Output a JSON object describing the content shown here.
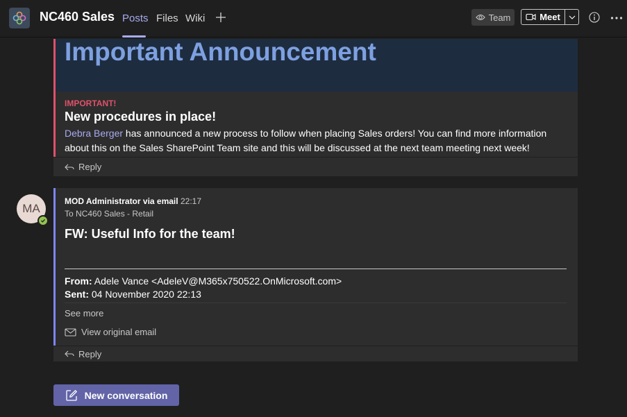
{
  "header": {
    "team_name": "NC460 Sales",
    "tabs": [
      {
        "label": "Posts",
        "active": true
      },
      {
        "label": "Files",
        "active": false
      },
      {
        "label": "Wiki",
        "active": false
      }
    ],
    "add_tab_icon": "plus-icon",
    "team_button_label": "Team",
    "meet_button_label": "Meet",
    "info_icon": "info-icon",
    "more_icon": "more-options-icon"
  },
  "announcement": {
    "banner_title": "Important Announcement",
    "importance_label": "IMPORTANT!",
    "subject": "New procedures in place!",
    "mention": "Debra Berger",
    "body_line1_rest": " has announced a new process to follow when placing Sales orders!  You can find more information",
    "body_line2": "about this on the Sales SharePoint Team site and this will be discussed at the next team meeting next week!",
    "reply_label": "Reply"
  },
  "email_post": {
    "avatar_initials": "MA",
    "sender": "MOD Administrator via email",
    "time": "22:17",
    "to_line": "To NC460 Sales - Retail",
    "subject": "FW: Useful Info for the team!",
    "from_label": "From:",
    "from_value": " Adele Vance <AdeleV@M365x750522.OnMicrosoft.com>",
    "sent_label": "Sent:",
    "sent_value": " 04 November 2020 22:13",
    "see_more_label": "See more",
    "view_original_label": "View original email",
    "reply_label": "Reply"
  },
  "new_conversation_label": "New conversation",
  "colors": {
    "accent": "#a8abef",
    "brand": "#6264a7",
    "important": "#e0516b",
    "banner_bg": "#1e2c3f",
    "banner_text": "#7da0e0",
    "presence_available": "#92c353"
  }
}
